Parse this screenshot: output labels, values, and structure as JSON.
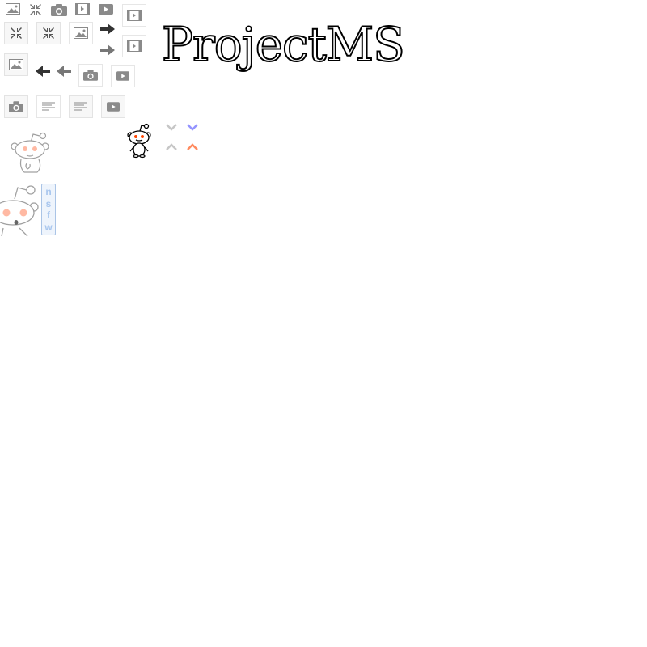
{
  "brand": {
    "title": "ProjectMS"
  },
  "badges": {
    "nsfw": [
      "n",
      "s",
      "f",
      "w"
    ]
  },
  "sprites": {
    "row1": [
      "image-icon",
      "collapse-icon",
      "camera-icon",
      "film-icon",
      "play-icon",
      "film-icon"
    ],
    "row2": [
      "collapse-icon",
      "collapse-icon",
      "image-icon",
      "arrow-right-icon",
      "arrow-right-icon",
      "film-icon"
    ],
    "row3": [
      "image-icon",
      "arrow-left-icon",
      "arrow-left-icon",
      "camera-icon",
      "play-icon"
    ],
    "row4": [
      "camera-icon",
      "text-post-icon",
      "text-post-icon",
      "play-icon"
    ],
    "votes": [
      "downvote-arrow",
      "downvote-arrow-active",
      "upvote-arrow",
      "upvote-arrow-active"
    ],
    "mascots": [
      "reddit-alien-thinking",
      "reddit-alien-surprised",
      "reddit-alien-small"
    ]
  },
  "colors": {
    "icon_gray": "#8a8a8a",
    "arrow_dark": "#333333",
    "upvote": "#ff8b60",
    "downvote": "#9494ff",
    "vote_neutral": "#c6c6c6",
    "nsfw_text": "#a8c6ee"
  }
}
